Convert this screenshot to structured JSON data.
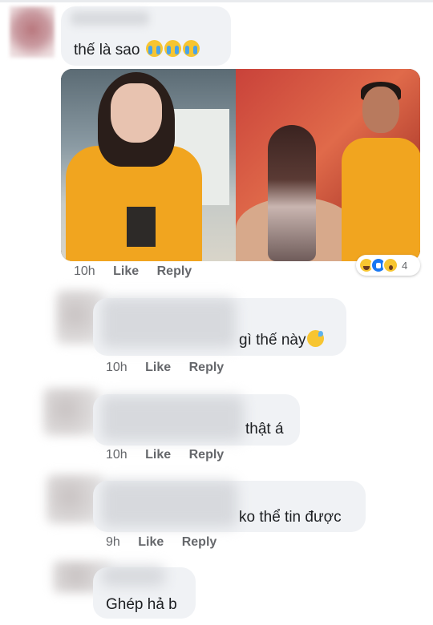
{
  "comments": [
    {
      "text": "thế là sao",
      "emojis": [
        "crying-face",
        "crying-face",
        "crying-face"
      ],
      "time": "10h",
      "like": "Like",
      "reply": "Reply",
      "reactions": {
        "icons": [
          "haha",
          "like",
          "wow"
        ],
        "count": "4"
      }
    },
    {
      "text": "gì thế này",
      "emojis": [
        "grinning-sweat-face"
      ],
      "time": "10h",
      "like": "Like",
      "reply": "Reply"
    },
    {
      "text": "thật á",
      "time": "10h",
      "like": "Like",
      "reply": "Reply"
    },
    {
      "text": "ko thể tin được",
      "time": "9h",
      "like": "Like",
      "reply": "Reply"
    },
    {
      "text": "Ghép hả b"
    }
  ],
  "colors": {
    "bubble": "#f0f2f5",
    "meta": "#65676b",
    "like_blue": "#1877f2"
  }
}
